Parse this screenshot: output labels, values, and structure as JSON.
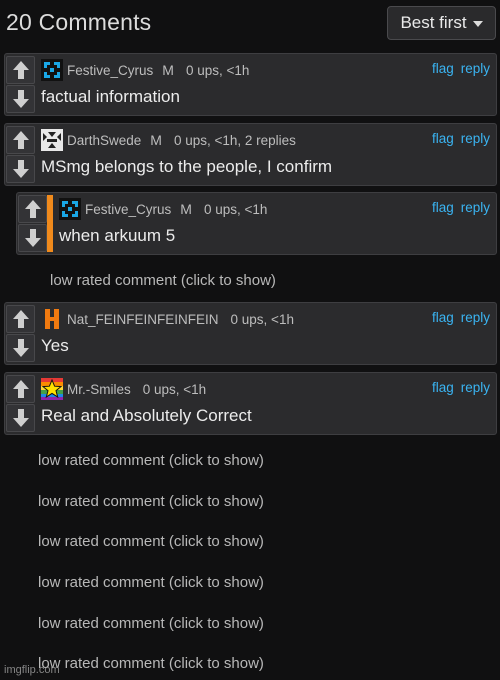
{
  "header": {
    "title": "20 Comments",
    "sort_label": "Best first"
  },
  "actions": {
    "flag": "flag",
    "reply": "reply"
  },
  "comments": [
    {
      "username": "Festive_Cyrus",
      "badge": "M",
      "info": "0 ups, <1h",
      "text": "factual information",
      "avatar_icon": "blue-bracket-avatar"
    },
    {
      "username": "DarthSwede",
      "badge": "M",
      "info": "0 ups, <1h, 2 replies",
      "text": "MSmg belongs to the people, I confirm",
      "avatar_icon": "checker-avatar"
    },
    {
      "username": "Festive_Cyrus",
      "badge": "M",
      "info": "0 ups, <1h",
      "text": "when arkuum 5",
      "avatar_icon": "blue-bracket-avatar",
      "reply_color": "#f08a1c"
    },
    {
      "username": "Nat_FEINFEINFEINFEIN",
      "badge": "",
      "info": "0 ups, <1h",
      "text": "Yes",
      "avatar_icon": "orange-h-avatar"
    },
    {
      "username": "Mr.-Smiles",
      "badge": "",
      "info": "0 ups, <1h",
      "text": "Real and Absolutely Correct",
      "avatar_icon": "rainbow-star-avatar"
    }
  ],
  "low_rated_label": "low rated comment (click to show)",
  "watermark": "imgflip.com",
  "colors": {
    "background": "#101011",
    "panel": "#2b2b2d",
    "link": "#3ab4f2",
    "reply_bar": "#f08a1c"
  }
}
